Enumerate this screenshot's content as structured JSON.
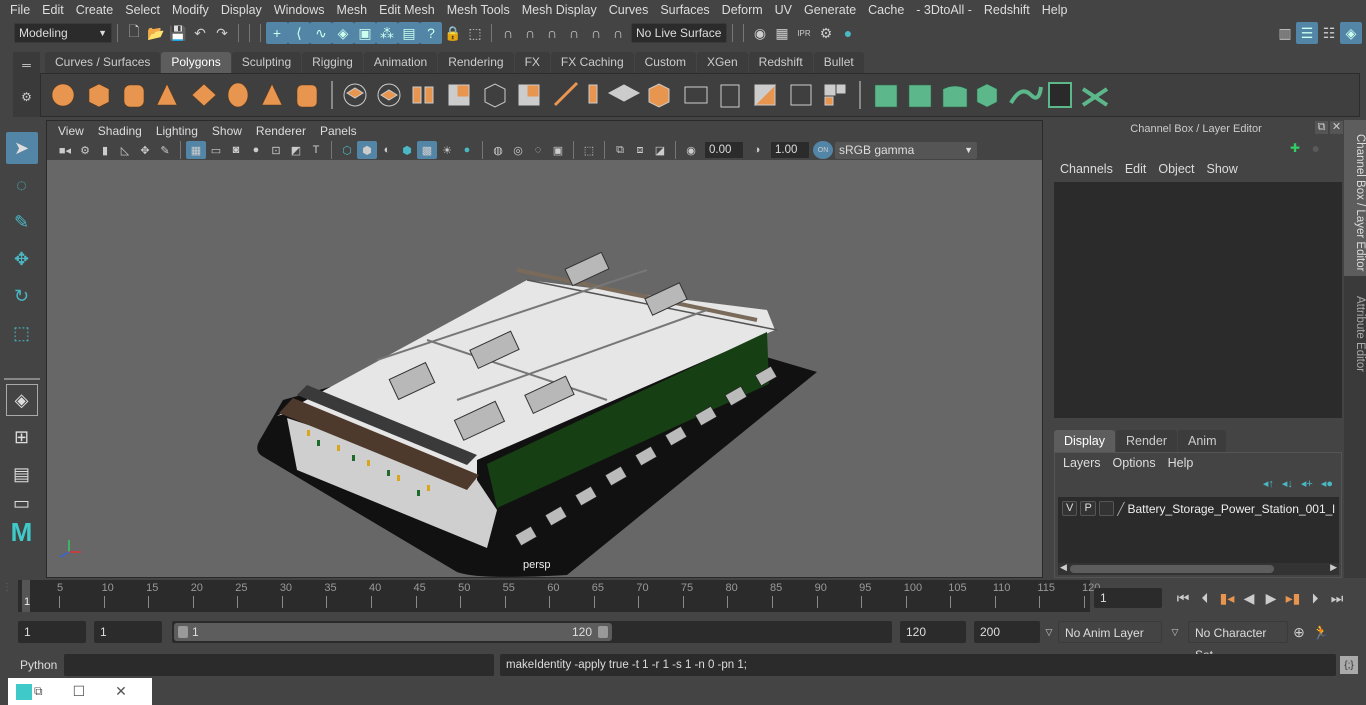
{
  "menubar": [
    "File",
    "Edit",
    "Create",
    "Select",
    "Modify",
    "Display",
    "Windows",
    "Mesh",
    "Edit Mesh",
    "Mesh Tools",
    "Mesh Display",
    "Curves",
    "Surfaces",
    "Deform",
    "UV",
    "Generate",
    "Cache",
    "- 3DtoAll -",
    "Redshift",
    "Help"
  ],
  "statusline": {
    "mode": "Modeling",
    "live_surface": "No Live Surface"
  },
  "shelf": {
    "tabs": [
      "Curves / Surfaces",
      "Polygons",
      "Sculpting",
      "Rigging",
      "Animation",
      "Rendering",
      "FX",
      "FX Caching",
      "Custom",
      "XGen",
      "Redshift",
      "Bullet"
    ],
    "active_tab": "Polygons"
  },
  "viewport": {
    "menu": [
      "View",
      "Shading",
      "Lighting",
      "Show",
      "Renderer",
      "Panels"
    ],
    "exposure": "0.00",
    "gamma": "1.00",
    "color_toggle": "ON",
    "colorspace": "sRGB gamma",
    "camera_label": "persp",
    "scene_object": "Battery Storage Power Station 3D model"
  },
  "channelbox": {
    "title": "Channel Box / Layer Editor",
    "menu": [
      "Channels",
      "Edit",
      "Object",
      "Show"
    ]
  },
  "layereditor": {
    "tabs": [
      "Display",
      "Render",
      "Anim"
    ],
    "active_tab": "Display",
    "menu": [
      "Layers",
      "Options",
      "Help"
    ],
    "layers": [
      {
        "v": "V",
        "p": "P",
        "name": "Battery_Storage_Power_Station_001_l"
      }
    ]
  },
  "sidetabs": [
    "Channel Box / Layer Editor",
    "Attribute Editor"
  ],
  "timeline": {
    "ticks": [
      5,
      10,
      15,
      20,
      25,
      30,
      35,
      40,
      45,
      50,
      55,
      60,
      65,
      70,
      75,
      80,
      85,
      90,
      95,
      100,
      105,
      110,
      115,
      120
    ],
    "start_label": "1",
    "current_frame": "1",
    "max": 120
  },
  "range": {
    "start": "1",
    "playback_start": "1",
    "range_start_label": "1",
    "range_end_label": "120",
    "playback_end": "120",
    "end": "200",
    "anim_layer": "No Anim Layer",
    "character_set": "No Character Set"
  },
  "cmdline": {
    "language": "Python",
    "input": "",
    "result": "makeIdentity -apply true -t 1 -r 1 -s 1 -n 0 -pn 1;"
  }
}
